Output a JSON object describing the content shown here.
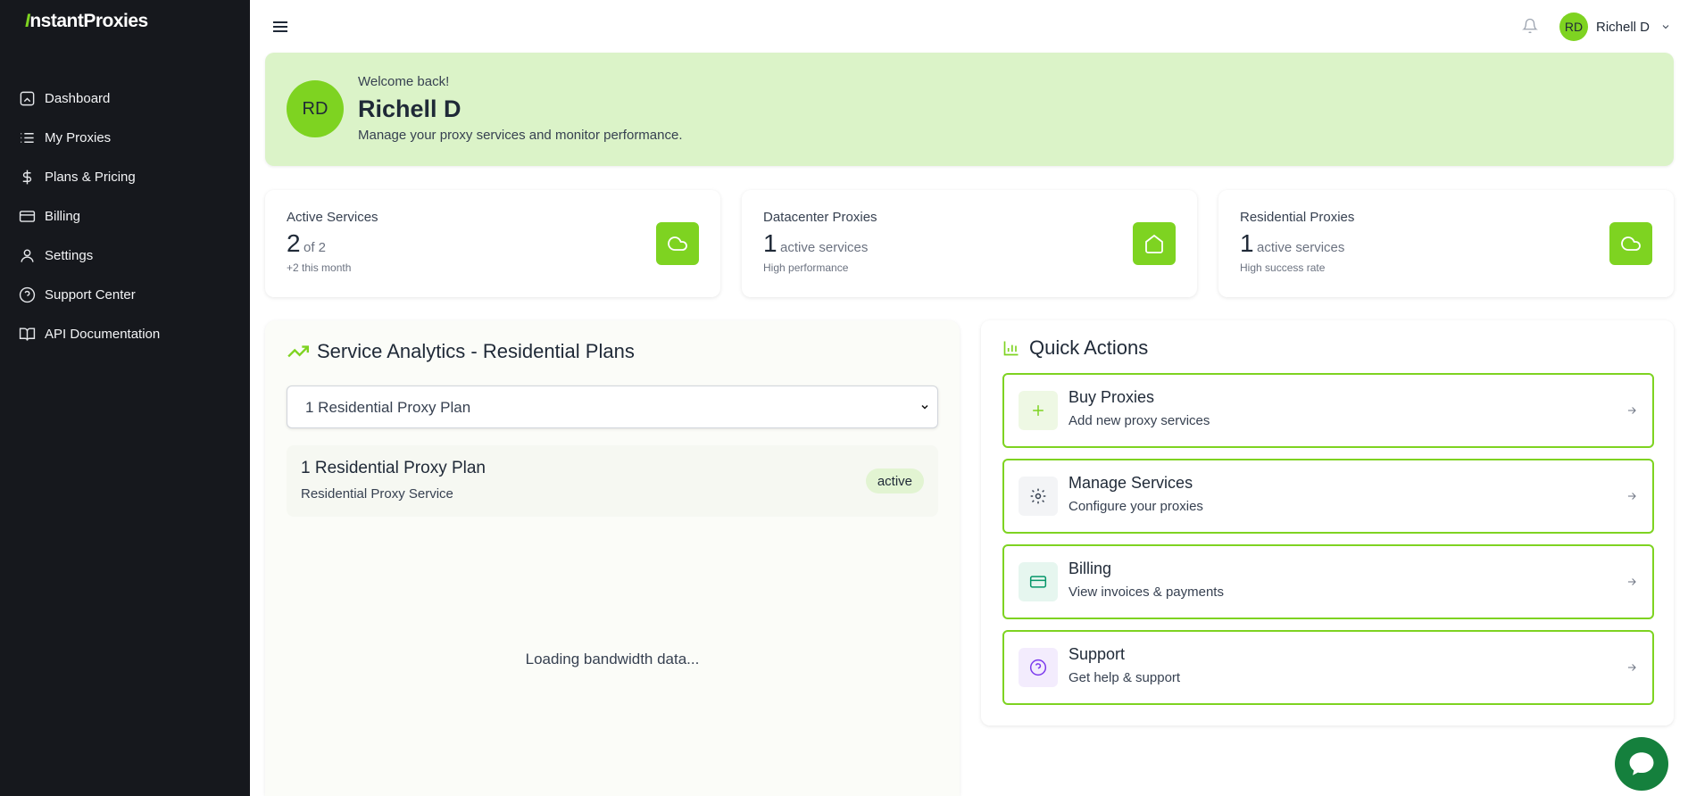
{
  "brand": {
    "logo_mark": "I",
    "logo_text": "nstantProxies"
  },
  "sidebar": {
    "items": [
      {
        "label": "Dashboard",
        "icon": "dashboard-icon"
      },
      {
        "label": "My Proxies",
        "icon": "list-icon"
      },
      {
        "label": "Plans & Pricing",
        "icon": "dollar-icon"
      },
      {
        "label": "Billing",
        "icon": "credit-card-icon"
      },
      {
        "label": "Settings",
        "icon": "user-icon"
      },
      {
        "label": "Support Center",
        "icon": "help-circle-icon"
      },
      {
        "label": "API Documentation",
        "icon": "book-icon"
      }
    ]
  },
  "header": {
    "user_initials": "RD",
    "user_name": "Richell D"
  },
  "welcome": {
    "initials": "RD",
    "subtitle": "Welcome back!",
    "name": "Richell D",
    "description": "Manage your proxy services and monitor performance."
  },
  "stats": [
    {
      "label": "Active Services",
      "value": "2",
      "suffix": "of 2",
      "note": "+2 this month",
      "icon": "cloud-icon"
    },
    {
      "label": "Datacenter Proxies",
      "value": "1",
      "suffix": "active services",
      "note": "High performance",
      "icon": "home-icon"
    },
    {
      "label": "Residential Proxies",
      "value": "1",
      "suffix": "active services",
      "note": "High success rate",
      "icon": "cloud-icon"
    }
  ],
  "analytics": {
    "title": "Service Analytics - Residential Plans",
    "selected_plan": "1 Residential Proxy Plan",
    "plan_title": "1 Residential Proxy Plan",
    "plan_subtitle": "Residential Proxy Service",
    "status": "active",
    "loading_text": "Loading bandwidth data..."
  },
  "quick_actions": {
    "title": "Quick Actions",
    "items": [
      {
        "title": "Buy Proxies",
        "subtitle": "Add new proxy services",
        "icon": "plus-icon",
        "color": "#7ed321",
        "bg": "#eef8e4"
      },
      {
        "title": "Manage Services",
        "subtitle": "Configure your proxies",
        "icon": "gear-icon",
        "color": "#374151",
        "bg": "#f3f4f6"
      },
      {
        "title": "Billing",
        "subtitle": "View invoices & payments",
        "icon": "credit-card-icon",
        "color": "#059669",
        "bg": "#e6f6ef"
      },
      {
        "title": "Support",
        "subtitle": "Get help & support",
        "icon": "help-circle-icon",
        "color": "#7c3aed",
        "bg": "#f3ecfd"
      }
    ]
  },
  "colors": {
    "accent": "#7ed321",
    "sidebar_bg": "#16181d",
    "welcome_bg": "#dbf3c8",
    "chat_bg": "#15803d"
  }
}
